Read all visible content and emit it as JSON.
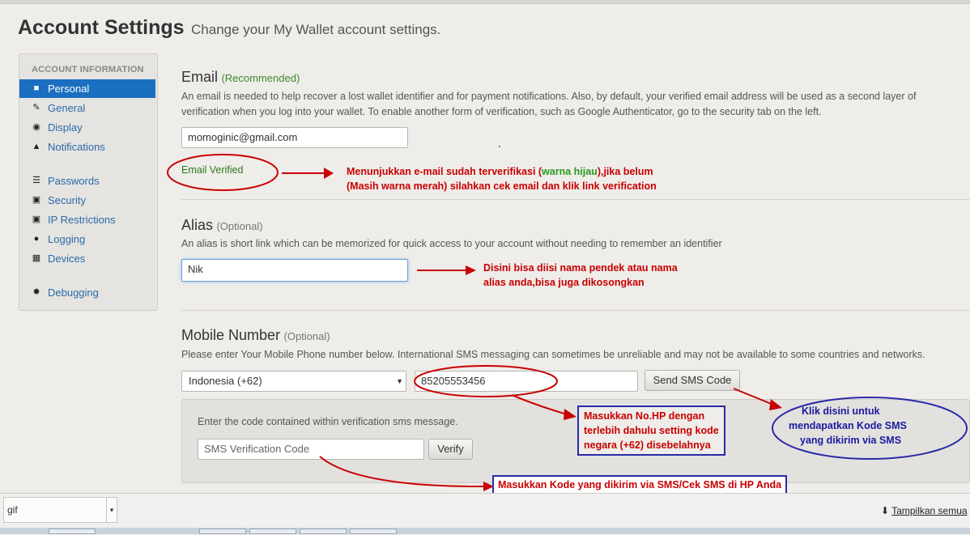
{
  "header": {
    "title": "Account Settings",
    "subtitle": "Change your My Wallet account settings."
  },
  "sidebar": {
    "heading": "ACCOUNT INFORMATION",
    "items": [
      {
        "label": "Personal",
        "icon": "user-icon",
        "active": true
      },
      {
        "label": "General",
        "icon": "wrench-icon"
      },
      {
        "label": "Display",
        "icon": "eye-icon"
      },
      {
        "label": "Notifications",
        "icon": "bell-icon"
      },
      {
        "label": "Passwords",
        "icon": "list-icon"
      },
      {
        "label": "Security",
        "icon": "lock-icon"
      },
      {
        "label": "IP Restrictions",
        "icon": "lock-icon"
      },
      {
        "label": "Logging",
        "icon": "info-circle-icon"
      },
      {
        "label": "Devices",
        "icon": "qrcode-icon"
      },
      {
        "label": "Debugging",
        "icon": "bug-icon"
      }
    ]
  },
  "email": {
    "title": "Email",
    "tag": "(Recommended)",
    "description": "An email is needed to help recover a lost wallet identifier and for payment notifications. Also, by default, your verified email address will be used as a second layer of verification when you log into your wallet. To enable another form of verification, such as Google Authenticator, go to the security tab on the left.",
    "value": "momoginic@gmail.com",
    "status": "Email Verified"
  },
  "alias": {
    "title": "Alias",
    "tag": "(Optional)",
    "description": "An alias is short link which can be memorized for quick access to your account without needing to remember an identifier",
    "value": "Nik"
  },
  "mobile": {
    "title": "Mobile Number",
    "tag": "(Optional)",
    "description": "Please enter Your Mobile Phone number below. International SMS messaging can sometimes be unreliable and may not be available to some countries and networks.",
    "country": "Indonesia (+62)",
    "number": "85205553456",
    "send_button": "Send SMS Code",
    "verify_label": "Enter the code contained within verification sms message.",
    "code_placeholder": "SMS Verification Code",
    "verify_button": "Verify"
  },
  "annotations": {
    "email_line1_a": "Menunjukkan e-mail sudah terverifikasi (",
    "email_line1_green": "warna hijau",
    "email_line1_b": "),jika belum",
    "email_line2": "(Masih warna merah) silahkan cek email dan klik link verification",
    "alias_line1": "Disini bisa diisi nama pendek atau nama",
    "alias_line2": "alias anda,bisa juga dikosongkan",
    "phone_line1": "Masukkan No.HP dengan",
    "phone_line2": "terlebih dahulu setting kode",
    "phone_line3": "negara (+62) disebelahnya",
    "sms_line1": "Klik disini untuk",
    "sms_line2": "mendapatkan Kode SMS",
    "sms_line3": "yang dikirim via SMS",
    "code_note": "Masukkan Kode yang dikirim via SMS/Cek SMS di HP Anda"
  },
  "browser": {
    "download_item": "gif",
    "show_all": "Tampilkan semua"
  },
  "colors": {
    "accent": "#1a6fc0",
    "annotation_red": "#c80000",
    "annotation_blue": "#2a2aa8",
    "verified_green": "#2a7a1d"
  }
}
